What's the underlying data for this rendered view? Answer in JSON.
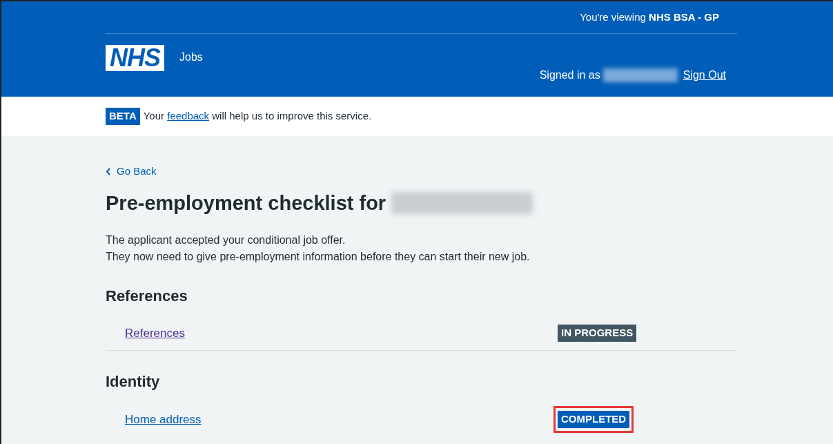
{
  "header": {
    "viewing_prefix": "You're viewing ",
    "organisation": "NHS BSA - GP",
    "logo": "NHS",
    "service": "Jobs",
    "signed_in_label": "Signed in as",
    "sign_out": "Sign Out"
  },
  "phase_banner": {
    "tag": "BETA",
    "text_before": "Your ",
    "link": "feedback",
    "text_after": " will help us to improve this service."
  },
  "back_link": "Go Back",
  "heading": "Pre-employment checklist for",
  "intro": [
    "The applicant accepted your conditional job offer.",
    "They now need to give pre-employment information before they can start their new job."
  ],
  "sections": [
    {
      "title": "References",
      "tasks": [
        {
          "label": "References",
          "visited": true,
          "status": "IN PROGRESS",
          "kind": "in-progress",
          "highlighted": false
        }
      ]
    },
    {
      "title": "Identity",
      "tasks": [
        {
          "label": "Home address",
          "visited": false,
          "status": "COMPLETED",
          "kind": "completed",
          "highlighted": true
        }
      ]
    }
  ]
}
